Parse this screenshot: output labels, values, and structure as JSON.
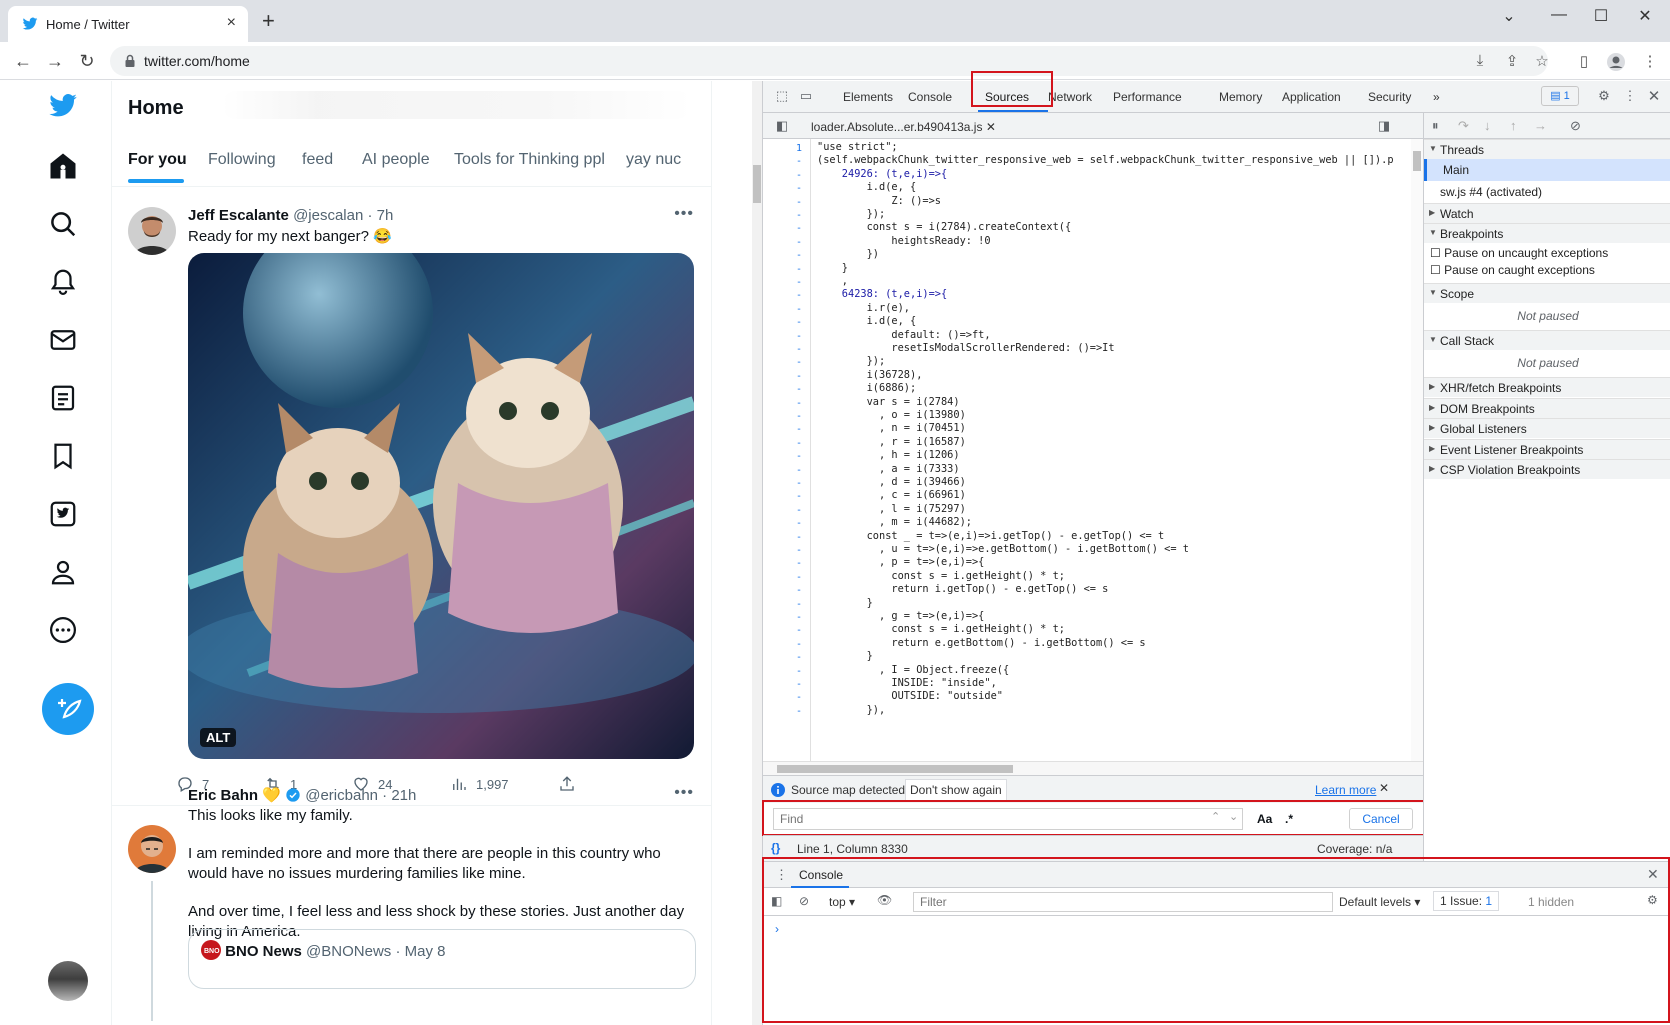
{
  "browser": {
    "tab_title": "Home / Twitter",
    "url": "twitter.com/home",
    "close_tab": "×",
    "new_tab": "+"
  },
  "twitter": {
    "page_title": "Home",
    "tabs": [
      "For you",
      "Following",
      "feed",
      "AI people",
      "Tools for Thinking ppl",
      "yay nuc"
    ],
    "tweet1": {
      "name": "Jeff Escalante",
      "handle": "@jescalan · 7h",
      "text": "Ready for my next banger? 😂",
      "alt": "ALT",
      "replies": "7",
      "retweets": "1",
      "likes": "24",
      "views": "1,997"
    },
    "tweet2": {
      "name": "Eric Bahn",
      "handle": "@ericbahn · 21h",
      "text_lines": [
        "This looks like my family.",
        "",
        "I am reminded more and more that there are people in this country who",
        "would have no issues murdering families like mine.",
        "",
        "And over time, I feel less and less shock by these stories. Just another day",
        "living in America."
      ],
      "quote_name": "BNO News",
      "quote_handle": "@BNONews · May 8"
    }
  },
  "devtools": {
    "tabs": [
      "Elements",
      "Console",
      "Sources",
      "Network",
      "Performance",
      "Memory",
      "Application",
      "Security"
    ],
    "more_tabs": "»",
    "issue_count": "1",
    "source_file": "loader.Absolute...er.b490413a.js",
    "source_map_text": "Source map detected.",
    "dont_show": "Don't show again",
    "learn_more": "Learn more",
    "find_placeholder": "Find",
    "find_case": "Aa",
    "find_regex": ".*",
    "find_cancel": "Cancel",
    "cursor_position": "Line 1, Column 8330",
    "coverage": "Coverage: n/a",
    "debugger": {
      "threads": "Threads",
      "thread_main": "Main",
      "thread_sw": "sw.js #4 (activated)",
      "watch": "Watch",
      "breakpoints": "Breakpoints",
      "pause_uncaught": "Pause on uncaught exceptions",
      "pause_caught": "Pause on caught exceptions",
      "scope": "Scope",
      "not_paused": "Not paused",
      "call_stack": "Call Stack",
      "xhr": "XHR/fetch Breakpoints",
      "dom": "DOM Breakpoints",
      "global": "Global Listeners",
      "event": "Event Listener Breakpoints",
      "csp": "CSP Violation Breakpoints"
    },
    "console": {
      "tab": "Console",
      "context": "top",
      "filter_placeholder": "Filter",
      "levels": "Default levels",
      "issues": "1 Issue:",
      "issues_count": "1",
      "hidden": "1 hidden",
      "prompt": "›"
    },
    "code_lines": [
      [
        "1",
        "\"use strict\";"
      ],
      [
        "-",
        "(self.webpackChunk_twitter_responsive_web = self.webpackChunk_twitter_responsive_web || []).p"
      ],
      [
        "-",
        "    24926: (t,e,i)=>{"
      ],
      [
        "-",
        "        i.d(e, {"
      ],
      [
        "-",
        "            Z: ()=>s"
      ],
      [
        "-",
        "        });"
      ],
      [
        "-",
        "        const s = i(2784).createContext({"
      ],
      [
        "-",
        "            heightsReady: !0"
      ],
      [
        "-",
        "        })"
      ],
      [
        "-",
        "    }"
      ],
      [
        "-",
        "    ,"
      ],
      [
        "-",
        "    64238: (t,e,i)=>{"
      ],
      [
        "-",
        "        i.r(e),"
      ],
      [
        "-",
        "        i.d(e, {"
      ],
      [
        "-",
        "            default: ()=>ft,"
      ],
      [
        "-",
        "            resetIsModalScrollerRendered: ()=>It"
      ],
      [
        "-",
        "        });"
      ],
      [
        "-",
        "        i(36728),"
      ],
      [
        "-",
        "        i(6886);"
      ],
      [
        "-",
        "        var s = i(2784)"
      ],
      [
        "-",
        "          , o = i(13980)"
      ],
      [
        "-",
        "          , n = i(70451)"
      ],
      [
        "-",
        "          , r = i(16587)"
      ],
      [
        "-",
        "          , h = i(1206)"
      ],
      [
        "-",
        "          , a = i(7333)"
      ],
      [
        "-",
        "          , d = i(39466)"
      ],
      [
        "-",
        "          , c = i(66961)"
      ],
      [
        "-",
        "          , l = i(75297)"
      ],
      [
        "-",
        "          , m = i(44682);"
      ],
      [
        "-",
        "        const _ = t=>(e,i)=>i.getTop() - e.getTop() <= t"
      ],
      [
        "-",
        "          , u = t=>(e,i)=>e.getBottom() - i.getBottom() <= t"
      ],
      [
        "-",
        "          , p = t=>(e,i)=>{"
      ],
      [
        "-",
        "            const s = i.getHeight() * t;"
      ],
      [
        "-",
        "            return i.getTop() - e.getTop() <= s"
      ],
      [
        "-",
        "        }"
      ],
      [
        "-",
        "          , g = t=>(e,i)=>{"
      ],
      [
        "-",
        "            const s = i.getHeight() * t;"
      ],
      [
        "-",
        "            return e.getBottom() - i.getBottom() <= s"
      ],
      [
        "-",
        "        }"
      ],
      [
        "-",
        "          , I = Object.freeze({"
      ],
      [
        "-",
        "            INSIDE: \"inside\","
      ],
      [
        "-",
        "            OUTSIDE: \"outside\""
      ],
      [
        "-",
        "        }),"
      ]
    ]
  },
  "colors": {
    "twitter_blue": "#1d9bf0",
    "highlight_red": "#d3141c",
    "devtools_blue": "#1a73e8"
  }
}
